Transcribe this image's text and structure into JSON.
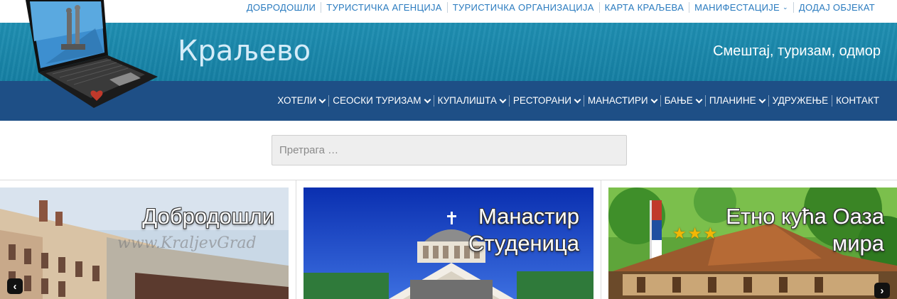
{
  "top_nav": [
    {
      "label": "ДОБРОДОШЛИ"
    },
    {
      "label": "ТУРИСТИЧКА АГЕНЦИЈА"
    },
    {
      "label": "ТУРИСТИЧКА ОРГАНИЗАЦИЈА"
    },
    {
      "label": "КАРТА КРАЉЕВА"
    },
    {
      "label": "МАНИФЕСТАЦИЈЕ",
      "dropdown": true
    },
    {
      "label": "ДОДАЈ ОБЈЕКАТ"
    }
  ],
  "header": {
    "title": "Краљево",
    "tagline": "Смештај, туризам, одмор"
  },
  "main_nav": [
    {
      "label": "ХОТЕЛИ",
      "dropdown": true
    },
    {
      "label": "СЕОСКИ ТУРИЗАМ",
      "dropdown": true
    },
    {
      "label": "КУПАЛИШТА",
      "dropdown": true
    },
    {
      "label": "РЕСТОРАНИ",
      "dropdown": true
    },
    {
      "label": "МАНАСТИРИ",
      "dropdown": true
    },
    {
      "label": "БАЊЕ",
      "dropdown": true
    },
    {
      "label": "ПЛАНИНЕ",
      "dropdown": true
    },
    {
      "label": "УДРУЖЕЊЕ"
    },
    {
      "label": "КОНТАКТ"
    }
  ],
  "search": {
    "placeholder": "Претрага …"
  },
  "slides": [
    {
      "caption": "Добродошли",
      "watermark": "www.KraljevGrad"
    },
    {
      "caption_line1": "Манастир",
      "caption_line2": "Студеница"
    },
    {
      "caption_line1": "Етно кућа Оаза",
      "caption_line2": "мира",
      "stars": "★★★"
    }
  ],
  "colors": {
    "header_top": "#1f8fb2",
    "header_bottom": "#1e4f86",
    "top_nav_text": "#2a7bbf"
  },
  "icons": {
    "prev": "chevron-left-icon",
    "next": "chevron-right-icon"
  }
}
